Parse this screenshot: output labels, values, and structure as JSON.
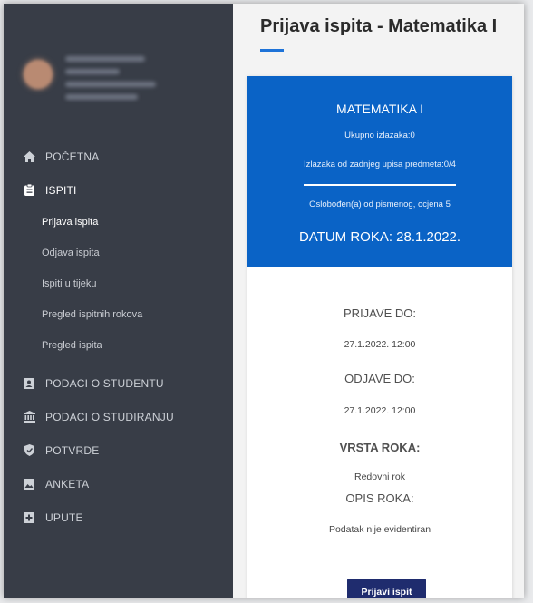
{
  "sidebar": {
    "items": [
      {
        "label": "POČETNA",
        "icon": "home-icon"
      },
      {
        "label": "ISPITI",
        "icon": "clipboard-icon"
      },
      {
        "label": "PODACI O STUDENTU",
        "icon": "id-card-icon"
      },
      {
        "label": "PODACI O STUDIRANJU",
        "icon": "institution-icon"
      },
      {
        "label": "POTVRDE",
        "icon": "shield-check-icon"
      },
      {
        "label": "ANKETA",
        "icon": "image-icon"
      },
      {
        "label": "UPUTE",
        "icon": "plus-square-icon"
      }
    ],
    "sub_items": [
      "Prijava ispita",
      "Odjava ispita",
      "Ispiti u tijeku",
      "Pregled ispitnih rokova",
      "Pregled ispita"
    ],
    "colors": {
      "bg": "#383d47",
      "text": "#cdd1d7"
    }
  },
  "page": {
    "title": "Prijava ispita - Matematika I",
    "accent": "#1e73d8"
  },
  "exam": {
    "subject": "MATEMATIKA I",
    "total_attempts": "Ukupno izlazaka:0",
    "attempts_since": "Izlazaka od zadnjeg upisa predmeta:0/4",
    "exemption": "Oslobođen(a) od pismenog, ocjena 5",
    "date": "DATUM ROKA: 28.1.2022.",
    "banner_color": "#0a63c6",
    "register_until_label": "PRIJAVE DO:",
    "register_until": "27.1.2022. 12:00",
    "deregister_until_label": "ODJAVE DO:",
    "deregister_until": "27.1.2022. 12:00",
    "type_label": "VRSTA ROKA:",
    "type": "Redovni rok",
    "desc_label": "OPIS ROKA:",
    "desc": "Podatak nije evidentiran",
    "register_button": "Prijavi ispit",
    "button_color": "#1f2c6e"
  }
}
